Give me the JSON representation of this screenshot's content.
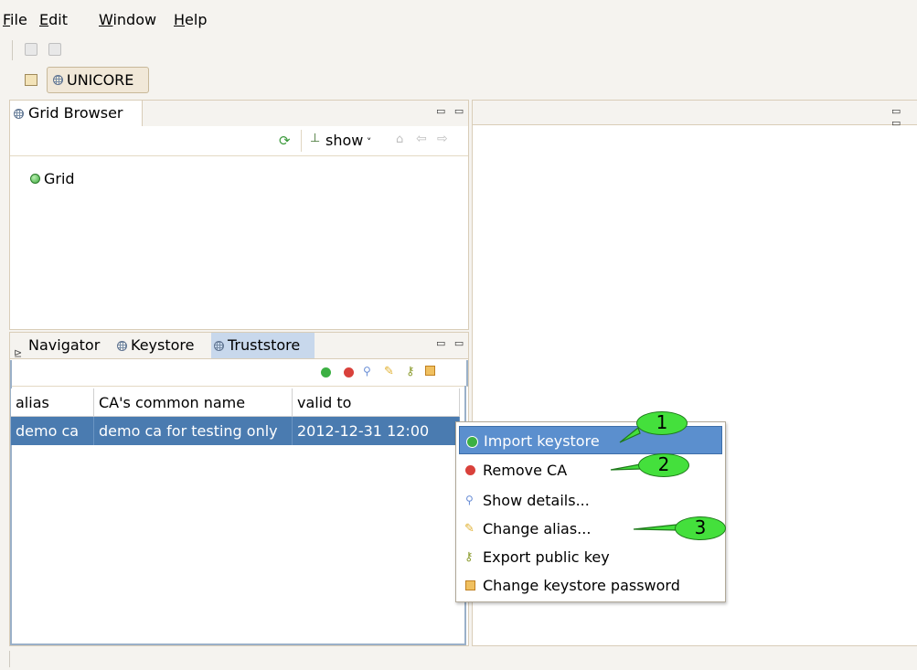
{
  "menubar": {
    "items": [
      {
        "label": "File",
        "mnemonic": "F",
        "rest": "ile"
      },
      {
        "label": "Edit",
        "mnemonic": "E",
        "rest": "dit"
      },
      {
        "label": "Window",
        "mnemonic": "W",
        "rest": "indow"
      },
      {
        "label": "Help",
        "mnemonic": "H",
        "rest": "elp"
      }
    ]
  },
  "perspective": {
    "label": "UNICORE"
  },
  "grid_browser": {
    "tab_label": "Grid Browser",
    "show_label": "show",
    "tree_root": "Grid"
  },
  "bottom_panel": {
    "tabs": [
      {
        "label": "Navigator"
      },
      {
        "label": "Keystore"
      },
      {
        "label": "Truststore"
      }
    ],
    "table": {
      "headers": [
        "alias",
        "CA's common name",
        "valid to"
      ],
      "rows": [
        [
          "demo ca",
          "demo ca for testing only",
          "2012-12-31 12:00"
        ]
      ]
    }
  },
  "context_menu": {
    "items": [
      {
        "label": "Import keystore",
        "icon": "add-icon",
        "color": "#3cb043"
      },
      {
        "label": "Remove CA",
        "icon": "remove-icon",
        "color": "#d9413b"
      },
      {
        "label": "Show details...",
        "icon": "magnifier-icon",
        "color": "#6b8fd6"
      },
      {
        "label": "Change alias...",
        "icon": "pencil-icon",
        "color": "#e0b030"
      },
      {
        "label": "Export public key",
        "icon": "key-export-icon",
        "color": "#8a9a2c"
      },
      {
        "label": "Change keystore password",
        "icon": "lock-icon",
        "color": "#d8a030"
      }
    ]
  },
  "callouts": [
    {
      "label": "1"
    },
    {
      "label": "2"
    },
    {
      "label": "3"
    }
  ],
  "colors": {
    "selection": "#4a7bb0",
    "menu_highlight": "#5b8fce",
    "callout_fill": "#44e03c",
    "panel_border": "#d9cdb8"
  }
}
